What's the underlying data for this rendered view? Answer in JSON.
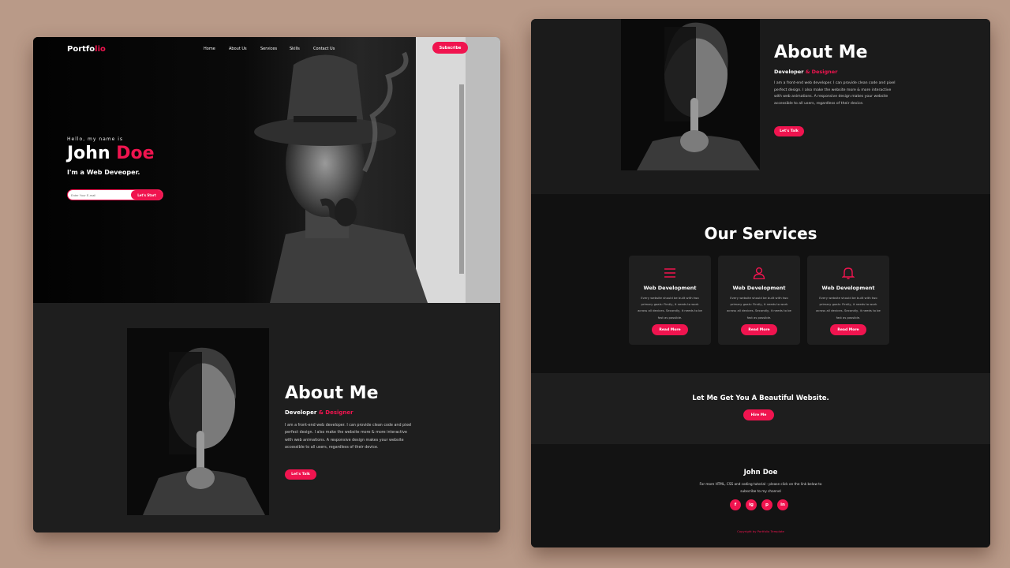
{
  "brand": {
    "logo_main": "Portfo",
    "logo_accent": "lio",
    "accent_color": "#f0144f"
  },
  "nav": {
    "links": [
      "Home",
      "About Us",
      "Services",
      "Skills",
      "Contact Us"
    ],
    "subscribe": "Subscribe"
  },
  "hero": {
    "greeting": "Hello, my name is",
    "first_name": "John",
    "last_name": "Doe",
    "role": "I'm a Web Deveoper.",
    "email_placeholder": "Enter Your E-mail",
    "start_label": "Let's Start"
  },
  "about": {
    "title": "About Me",
    "subtitle_main": "Developer",
    "subtitle_accent": "& Designer",
    "text": "I am a front-end web developer. I can provide clean code and pixel perfect design. I also make the website more & more interactive with web animations. A responsive design makes your website accessible to all users, regardless of their device.",
    "button": "Let's Talk"
  },
  "services": {
    "title": "Our Services",
    "items": [
      {
        "icon": "menu-icon",
        "title": "Web Development",
        "text": "Every website should be built with two primary goals: Firstly, it needs to work across all devices. Secondly, it needs to be fast as possible.",
        "button": "Read More"
      },
      {
        "icon": "user-icon",
        "title": "Web Development",
        "text": "Every website should be built with two primary goals: Firstly, it needs to work across all devices. Secondly, it needs to be fast as possible.",
        "button": "Read More"
      },
      {
        "icon": "bell-icon",
        "title": "Web Development",
        "text": "Every website should be built with two primary goals: Firstly, it needs to work across all devices. Secondly, it needs to be fast as possible.",
        "button": "Read More"
      }
    ]
  },
  "cta": {
    "title": "Let Me Get You A Beautiful Website.",
    "button": "Hire Me"
  },
  "footer": {
    "name": "John Doe",
    "text": "For more HTML, CSS and coding tutorial - please click on the link below to subscribe to my channel",
    "socials": [
      "f",
      "ig",
      "p",
      "in"
    ],
    "copyright": "Copyright by Portfolio Template"
  }
}
